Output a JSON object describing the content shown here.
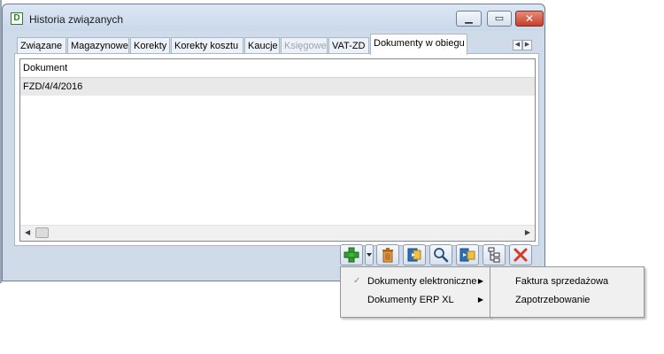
{
  "window": {
    "title": "Historia związanych",
    "app_icon_letter": "D"
  },
  "tabs": [
    {
      "label": "Związane",
      "state": "normal"
    },
    {
      "label": "Magazynowe",
      "state": "normal"
    },
    {
      "label": "Korekty",
      "state": "normal"
    },
    {
      "label": "Korekty kosztu",
      "state": "normal"
    },
    {
      "label": "Kaucje",
      "state": "normal"
    },
    {
      "label": "Księgowe",
      "state": "disabled"
    },
    {
      "label": "VAT-ZD",
      "state": "normal"
    },
    {
      "label": "Dokumenty w obiegu",
      "state": "active"
    }
  ],
  "grid": {
    "columns": [
      "Dokument"
    ],
    "rows": [
      [
        "FZD/4/4/2016"
      ]
    ]
  },
  "toolbar": {
    "buttons": [
      "add-icon",
      "dropdown-arrow-icon",
      "delete-icon",
      "edit-icon",
      "search-icon",
      "link-icon",
      "tree-icon",
      "close-icon"
    ]
  },
  "menu": {
    "items": [
      {
        "label": "Dokumenty elektroniczne",
        "checked": true,
        "has_submenu": true
      },
      {
        "label": "Dokumenty ERP XL",
        "checked": false,
        "has_submenu": true
      }
    ]
  },
  "submenu": {
    "items": [
      {
        "label": "Faktura sprzedażowa"
      },
      {
        "label": "Zapotrzebowanie"
      }
    ]
  },
  "colors": {
    "window_bg": "#cfdbe9",
    "close_button": "#c5402b",
    "add_green": "#2e9e2e",
    "delete_red": "#d83a2a"
  }
}
